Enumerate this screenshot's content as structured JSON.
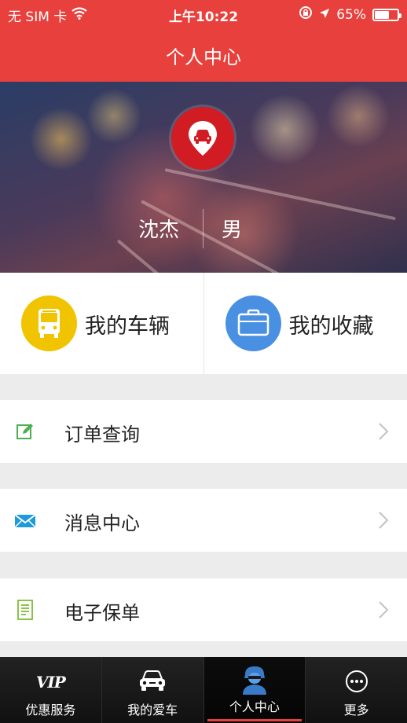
{
  "status_bar": {
    "carrier": "无 SIM 卡",
    "time": "上午10:22",
    "battery": "65%",
    "battery_level": 0.65,
    "icons": [
      "wifi-icon",
      "rotation-lock-icon",
      "location-arrow-icon",
      "battery-icon"
    ]
  },
  "header": {
    "title": "个人中心"
  },
  "profile": {
    "name": "沈杰",
    "gender": "男",
    "logo_icon": "car-pin-icon"
  },
  "quick_actions": [
    {
      "label": "我的车辆",
      "icon": "bus-icon",
      "color": "#f0c400"
    },
    {
      "label": "我的收藏",
      "icon": "briefcase-icon",
      "color": "#4a90e2"
    }
  ],
  "menu": [
    {
      "label": "订单查询",
      "icon": "edit-icon",
      "color": "#4caf50"
    },
    {
      "label": "消息中心",
      "icon": "envelope-icon",
      "color": "#1e9ad6"
    },
    {
      "label": "电子保单",
      "icon": "document-icon",
      "color": "#8bc34a"
    }
  ],
  "tabbar": {
    "vip_text": "VIP",
    "tabs": [
      {
        "label": "优惠服务",
        "icon": "vip-icon"
      },
      {
        "label": "我的爱车",
        "icon": "car-icon"
      },
      {
        "label": "个人中心",
        "icon": "user-icon",
        "active": true
      },
      {
        "label": "更多",
        "icon": "more-icon"
      }
    ]
  },
  "colors": {
    "accent": "#e8403c",
    "tabbar_bg": "#151515",
    "page_bg": "#ececec"
  }
}
